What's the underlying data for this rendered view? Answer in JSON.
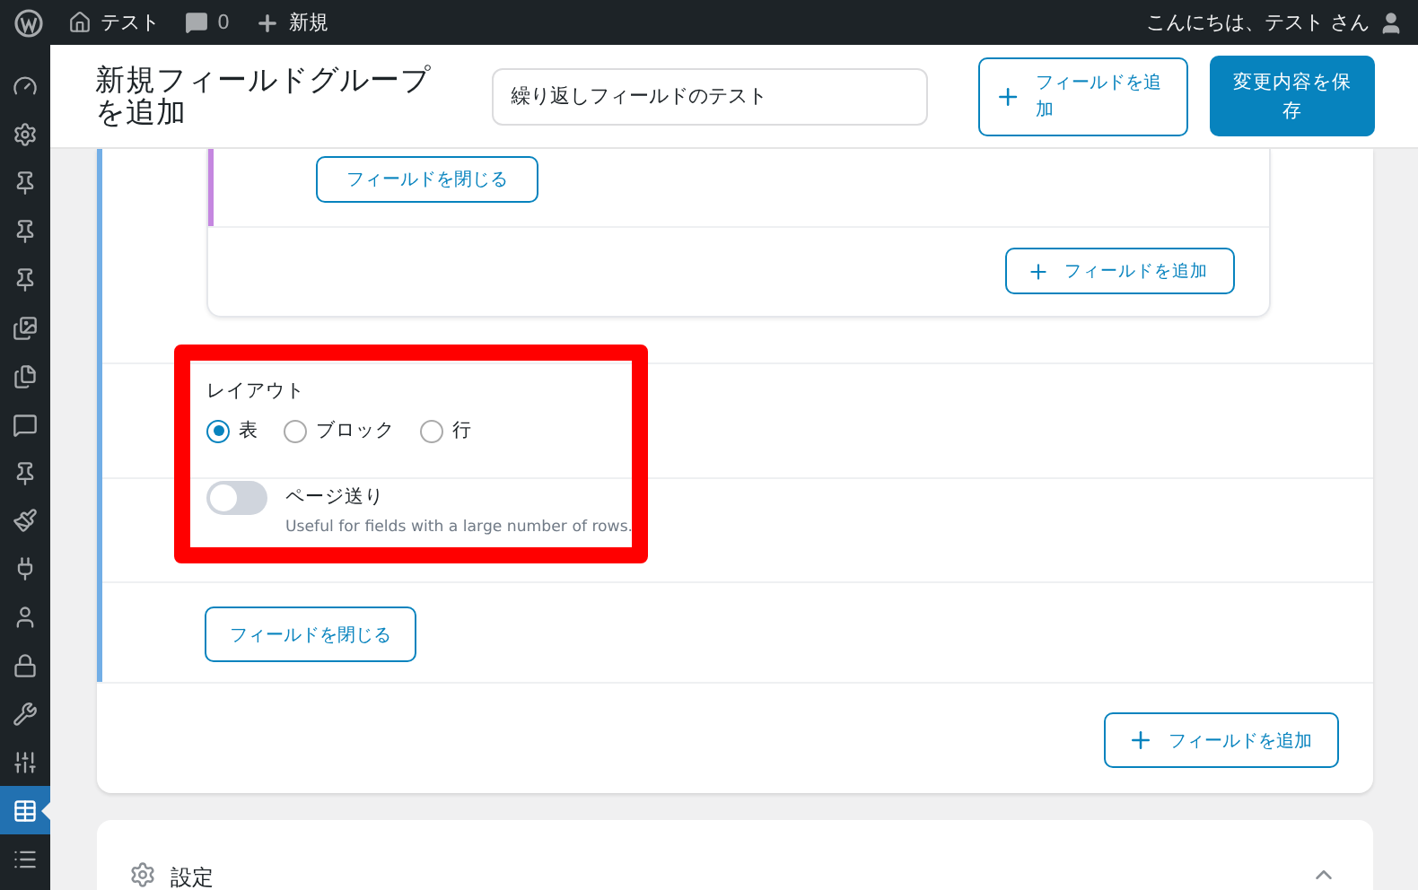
{
  "admin_bar": {
    "site": "テスト",
    "comments": "0",
    "new": "新規",
    "greeting": "こんにちは、テスト さん"
  },
  "sidebar": {
    "items": [
      {
        "kind": "dashboard",
        "selected": false
      },
      {
        "kind": "gear",
        "selected": false
      },
      {
        "kind": "pin",
        "selected": false
      },
      {
        "kind": "pin",
        "selected": false
      },
      {
        "kind": "pin",
        "selected": false
      },
      {
        "kind": "media",
        "selected": false
      },
      {
        "kind": "pages",
        "selected": false
      },
      {
        "kind": "comment",
        "selected": false
      },
      {
        "kind": "pin",
        "selected": false
      },
      {
        "kind": "brush",
        "selected": false
      },
      {
        "kind": "plug",
        "selected": false
      },
      {
        "kind": "user",
        "selected": false
      },
      {
        "kind": "lock",
        "selected": false
      },
      {
        "kind": "wrench",
        "selected": false
      },
      {
        "kind": "sliders",
        "selected": false
      },
      {
        "kind": "table",
        "selected": true
      },
      {
        "kind": "list",
        "selected": false
      }
    ]
  },
  "header": {
    "title": "新規フィールドグループを追加",
    "group_name": "繰り返しフィールドのテスト",
    "add_button": "フィールドを追加",
    "save_button": "変更内容を保存"
  },
  "subfield": {
    "close_button": "フィールドを閉じる",
    "add_button": "フィールドを追加"
  },
  "layout": {
    "label": "レイアウト",
    "options": [
      {
        "label": "表",
        "selected": true
      },
      {
        "label": "ブロック",
        "selected": false
      },
      {
        "label": "行",
        "selected": false
      }
    ]
  },
  "pagination": {
    "label": "ページ送り",
    "on": false,
    "help": "Useful for fields with a large number of rows."
  },
  "close_button": "フィールドを閉じる",
  "add_button": "フィールドを追加",
  "settings": {
    "title": "設定",
    "expanded": true
  }
}
